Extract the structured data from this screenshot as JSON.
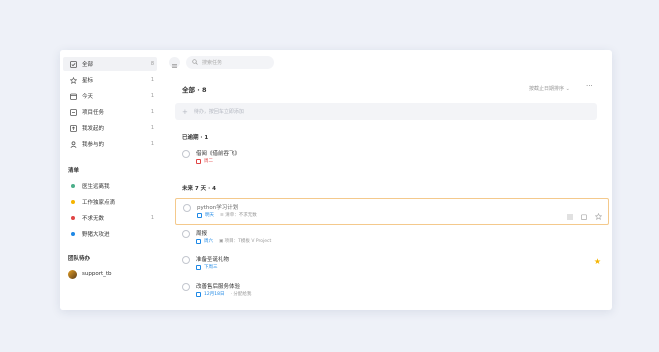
{
  "sidebar": {
    "items": [
      {
        "label": "全部",
        "count": "8",
        "icon": "checkbox-icon"
      },
      {
        "label": "星标",
        "count": "1",
        "icon": "star-outline-icon"
      },
      {
        "label": "今天",
        "count": "1",
        "icon": "calendar-today-icon"
      },
      {
        "label": "项目任务",
        "count": "1",
        "icon": "project-icon"
      },
      {
        "label": "我发起的",
        "count": "1",
        "icon": "sent-icon"
      },
      {
        "label": "我参与的",
        "count": "1",
        "icon": "person-icon"
      }
    ],
    "lists_heading": "清单",
    "lists": [
      {
        "label": "医生远离我",
        "count": "",
        "color": "#4caf8a"
      },
      {
        "label": "工作独家点滴",
        "count": "",
        "color": "#f5b400"
      },
      {
        "label": "不求无数",
        "count": "1",
        "color": "#e04545"
      },
      {
        "label": "野猪大攻进",
        "count": "",
        "color": "#1e88e5"
      }
    ],
    "team_heading": "团队待办",
    "team": [
      {
        "label": "support_tb"
      }
    ]
  },
  "main": {
    "search_placeholder": "搜索任务",
    "title": "全部 · 8",
    "sort_label": "按截止日期排序 ⌄",
    "more": "···",
    "add_placeholder": "待办，按回车立即添加",
    "sections": [
      {
        "label": "已逾期 · 1"
      },
      {
        "label": "未来 7 天 · 4"
      }
    ],
    "tasks": [
      {
        "title": "借阅《借前吞飞》",
        "date": "周二",
        "extra": ""
      },
      {
        "title": "python学习计划",
        "date": "明天",
        "extra": "≡  清单：不求无数"
      },
      {
        "title": "周报",
        "date": "周六",
        "extra": "▣  项目：T模板 V Project"
      },
      {
        "title": "准备圣诞礼物",
        "date": "下周三",
        "extra": ""
      },
      {
        "title": "改善售后服务体验",
        "date": "12月18日",
        "extra": "· 分配给我"
      }
    ]
  },
  "colors": {
    "accent": "#1e88e5",
    "overdue": "#e04545",
    "star": "#f5b400",
    "highlight_border": "#f4c98c"
  }
}
